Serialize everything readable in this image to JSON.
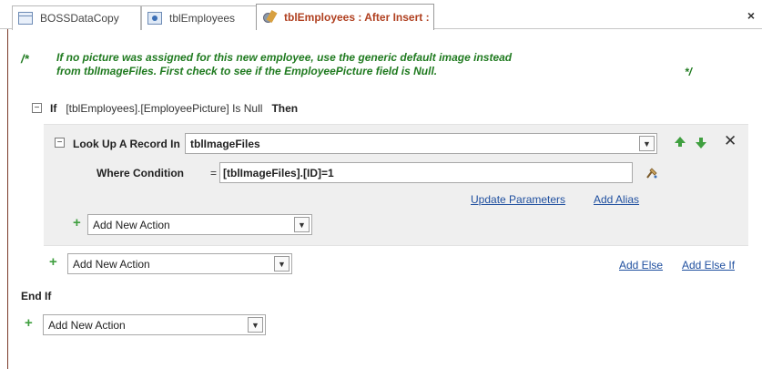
{
  "tabs": [
    {
      "label": "BOSSDataCopy",
      "icon": "table-icon"
    },
    {
      "label": "tblEmployees",
      "icon": "form-icon"
    },
    {
      "label": "tblEmployees : After Insert :",
      "icon": "macro-icon",
      "active": true
    }
  ],
  "close_label": "×",
  "comment": {
    "open": "/*",
    "line1": "If no picture was assigned for this new employee, use the generic default image instead",
    "line2": "from tblImageFiles. First check to see if the EmployeePicture field is Null.",
    "close": "*/"
  },
  "if_block": {
    "collapse": "⊟",
    "if_keyword": "If",
    "condition": "[tblEmployees].[EmployeePicture] Is Null",
    "then_keyword": "Then"
  },
  "lookup": {
    "collapse": "⊟",
    "label": "Look Up A Record In",
    "table": "tblImageFiles",
    "where_label": "Where Condition",
    "where_eq": "=",
    "where_value": "[tblImageFiles].[ID]=1",
    "update_parameters": "Update Parameters",
    "add_alias": "Add Alias",
    "delete": "✕"
  },
  "actions": {
    "plus": "+",
    "inner_add": "Add New Action",
    "if_add": "Add New Action",
    "root_add": "Add New Action"
  },
  "add_else": "Add Else",
  "add_else_if": "Add Else If",
  "end_if": "End If",
  "dropdown_glyph": "⌄",
  "colors": {
    "comment": "#1f7a1f",
    "link": "#1f4f9f",
    "active_tab": "#b04020",
    "plus": "#3f9f3f"
  }
}
